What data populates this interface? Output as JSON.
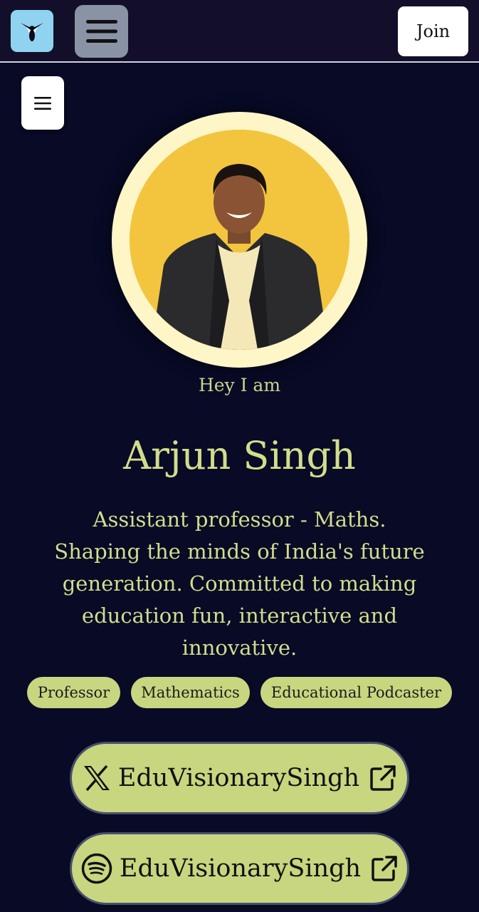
{
  "header": {
    "logo_icon": "owl-logo-icon",
    "menu_icon": "hamburger-menu-icon",
    "join_label": "Join"
  },
  "sidebar_toggle": {
    "icon": "hamburger-menu-icon"
  },
  "profile": {
    "greeting": "Hey I am",
    "name": "Arjun Singh",
    "bio": "Assistant professor - Maths. Shaping the minds of India's future generation. Committed to making education fun, interactive and innovative.",
    "tags": [
      "Professor",
      "Mathematics",
      "Educational Podcaster"
    ]
  },
  "links": [
    {
      "platform_icon": "x-logo-icon",
      "label": "EduVisionarySingh",
      "trailing_icon": "external-link-icon"
    },
    {
      "platform_icon": "spotify-icon",
      "label": "EduVisionarySingh",
      "trailing_icon": "external-link-icon"
    }
  ],
  "colors": {
    "background": "#080a26",
    "accent": "#c8d67f",
    "text_accent": "#d2dd8c",
    "avatar_bg": "#f3c53f"
  }
}
